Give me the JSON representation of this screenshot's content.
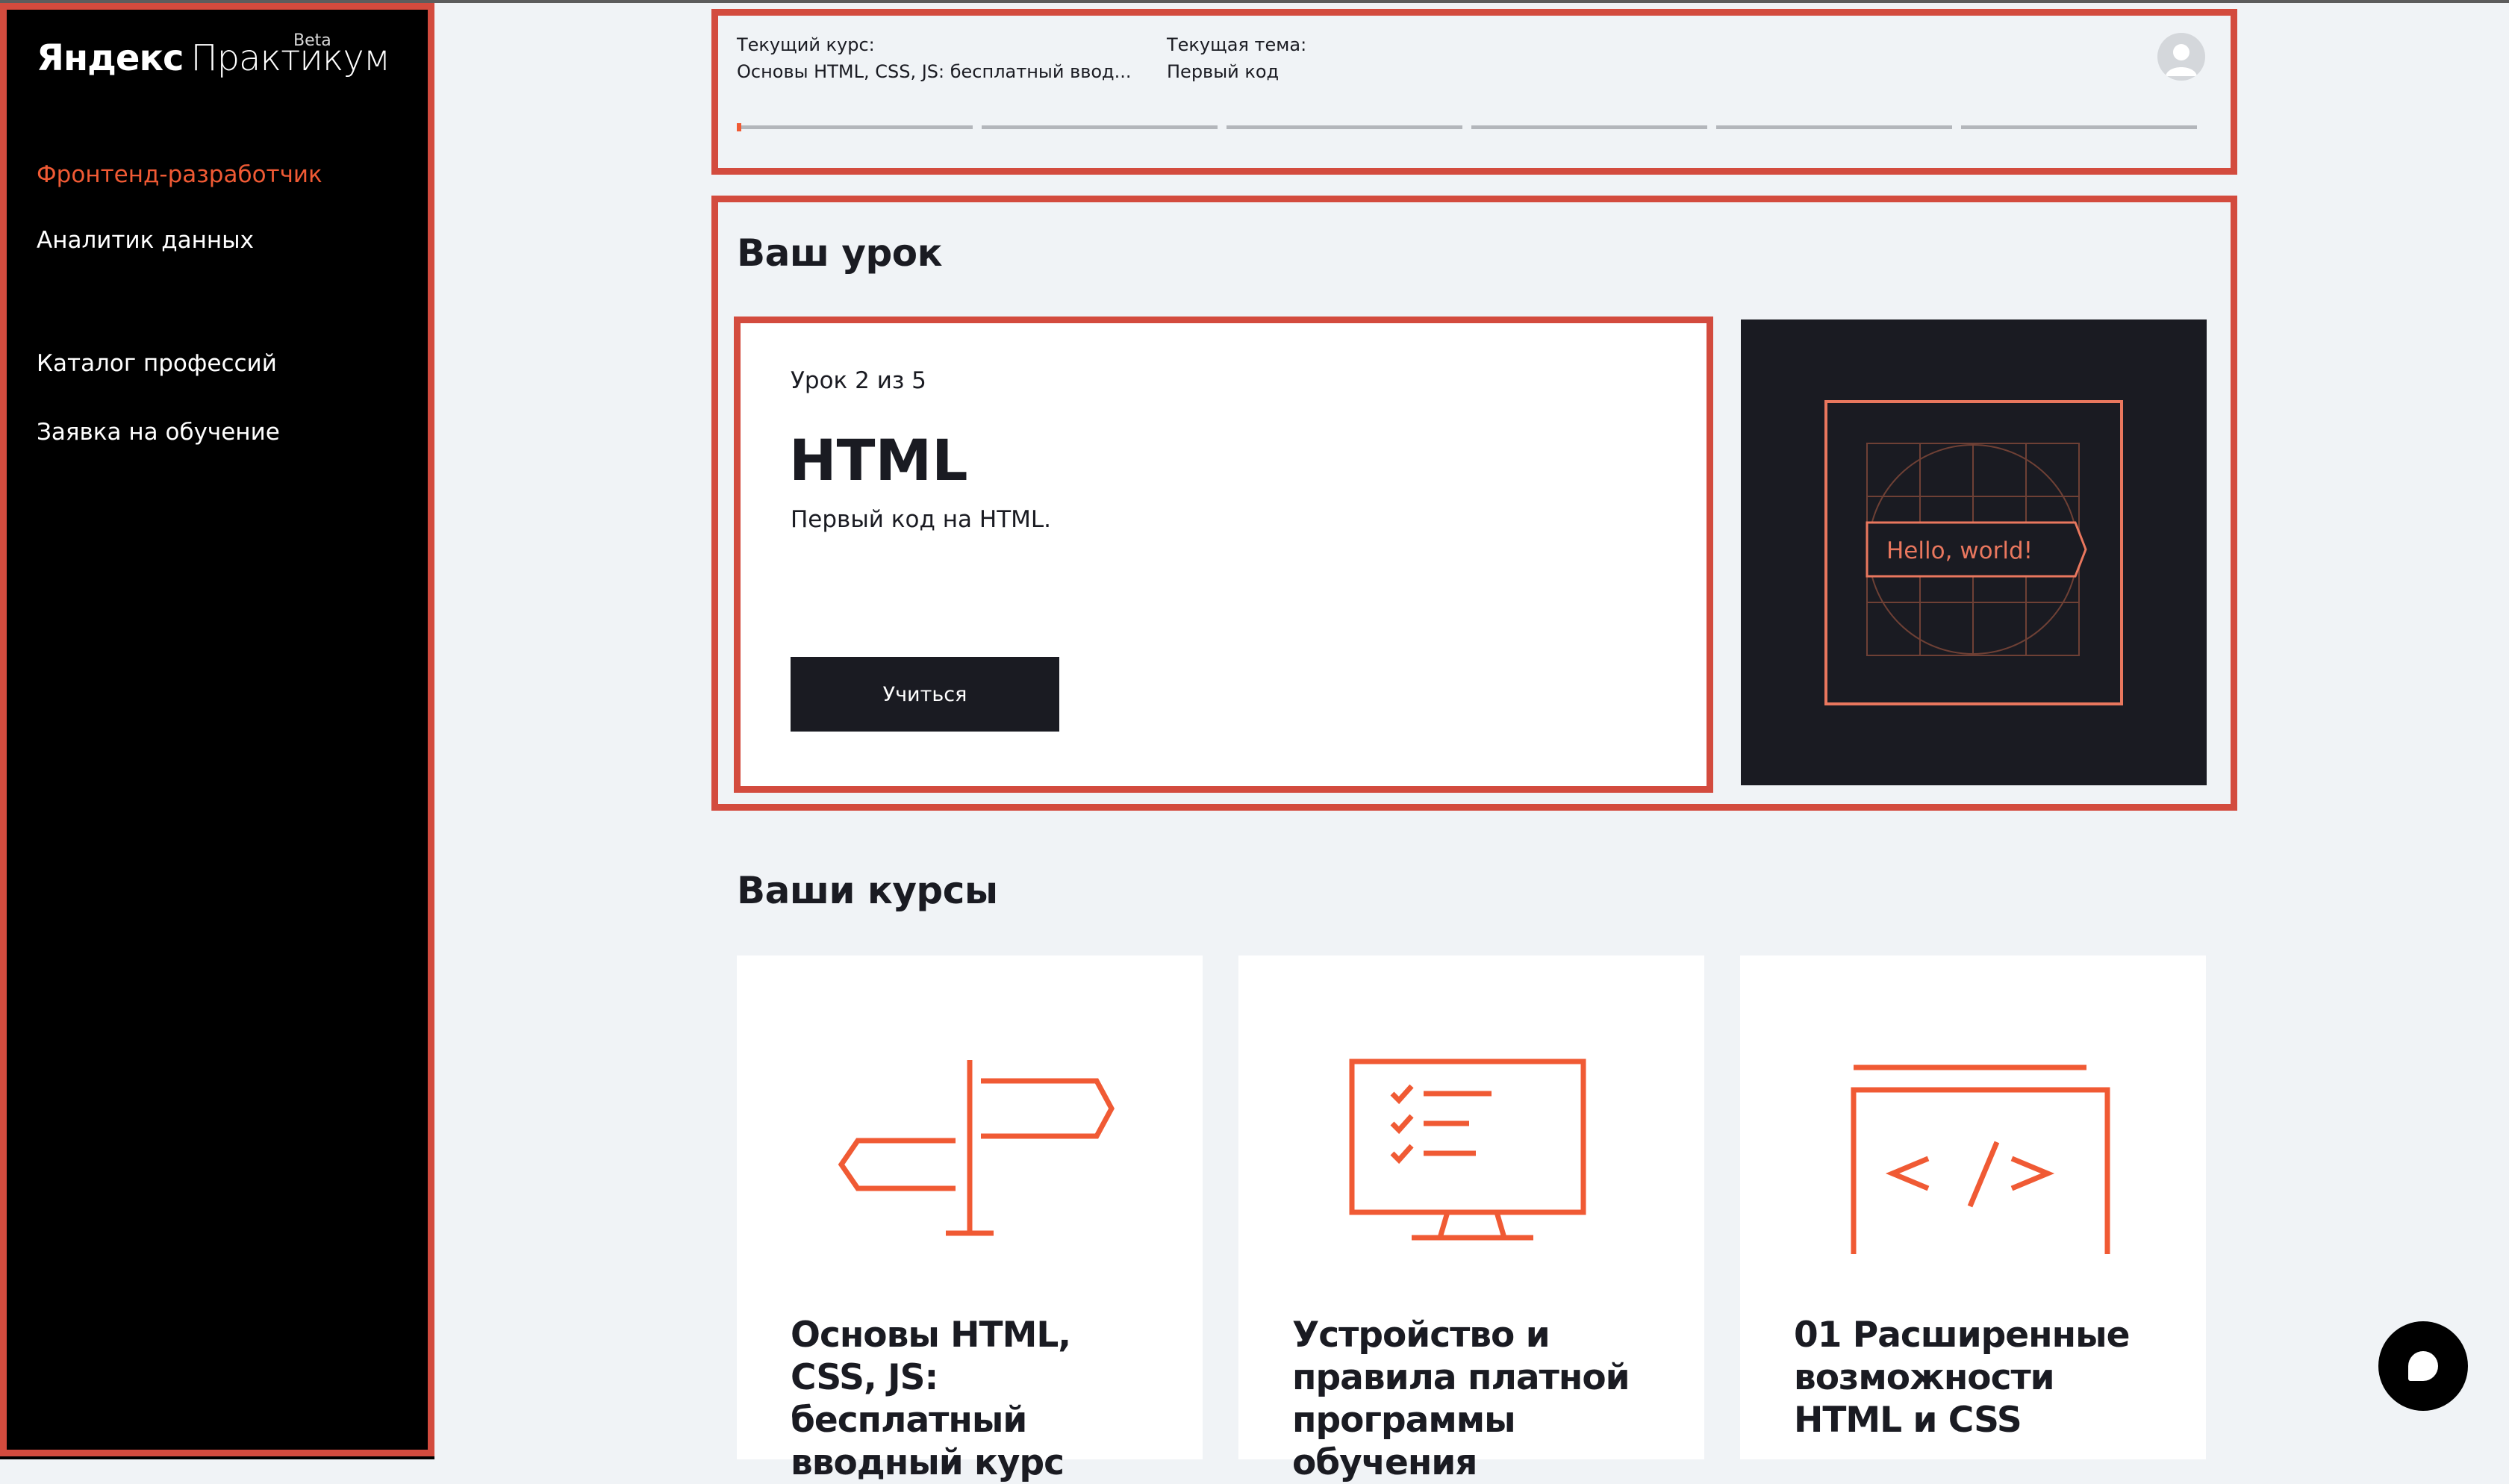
{
  "brand": {
    "logo_bold": "Яндекс",
    "logo_light": "Практикум",
    "badge": "Beta"
  },
  "sidebar": {
    "items": [
      {
        "label": "Фронтенд-разработчик",
        "active": true
      },
      {
        "label": "Аналитик данных"
      },
      {
        "label": "Каталог профессий"
      },
      {
        "label": "Заявка на обучение"
      }
    ]
  },
  "header": {
    "course_label": "Текущий курс:",
    "course_value": "Основы HTML, CSS, JS: бесплатный ввод...",
    "topic_label": "Текущая тема:",
    "topic_value": "Первый код",
    "progress_segments": 6,
    "progress_first_fill": 0.02
  },
  "lesson": {
    "section_title": "Ваш урок",
    "count": "Урок 2 из 5",
    "title": "HTML",
    "description": "Первый код на HTML.",
    "button": "Учиться",
    "image_text": "Hello, world!"
  },
  "courses": {
    "section_title": "Ваши курсы",
    "items": [
      {
        "title": "Основы HTML, CSS, JS: бесплатный вводный курс",
        "icon": "signpost-icon"
      },
      {
        "title": "Устройство и правила платной программы обучения",
        "icon": "monitor-checklist-icon"
      },
      {
        "title": "01 Расширенные возможности HTML и CSS",
        "icon": "code-window-icon"
      }
    ]
  },
  "colors": {
    "accent": "#f05a34",
    "highlight": "#d34b3e",
    "dark": "#1a1b22",
    "page_bg": "#f0f3f6"
  }
}
